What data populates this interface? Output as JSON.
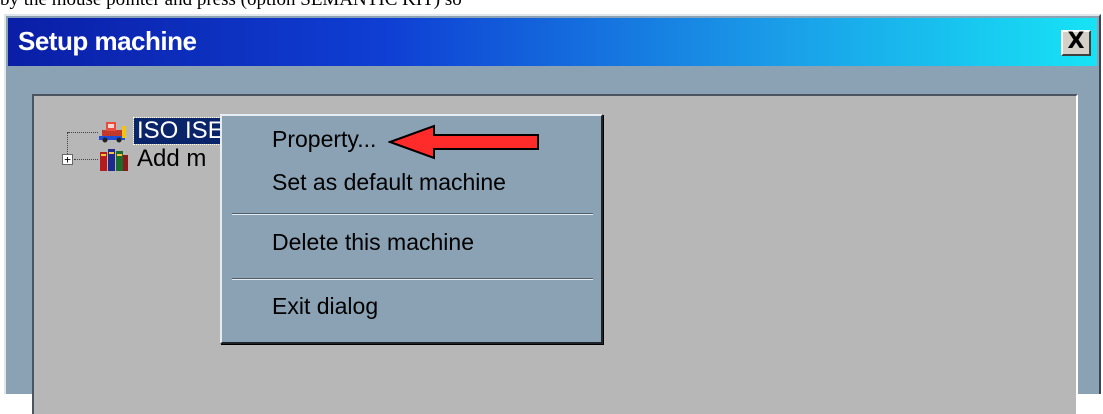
{
  "top_fragment": "by the mouse pointer and press (option SEMANTIC KIT) so",
  "window": {
    "title": "Setup machine",
    "close_label": "X"
  },
  "tree": {
    "items": [
      {
        "label": "ISO ISEL",
        "icon": "machine-icon",
        "selected": true
      },
      {
        "label": "Add m",
        "icon": "books-icon",
        "expandable": true
      }
    ],
    "expand_symbol": "+"
  },
  "context_menu": {
    "items": [
      {
        "label": "Property..."
      },
      {
        "label": "Set as default machine"
      },
      {
        "label": "Delete this machine"
      },
      {
        "label": "Exit dialog"
      }
    ]
  },
  "annotation": {
    "arrow_color": "#ff2a2a",
    "arrow_target": "Property..."
  },
  "colors": {
    "titlebar_start": "#0a1ea6",
    "titlebar_end": "#17e3f5",
    "window_bg": "#8aa2b4",
    "panel_bg": "#b7b7b7",
    "selection": "#0a246a"
  }
}
